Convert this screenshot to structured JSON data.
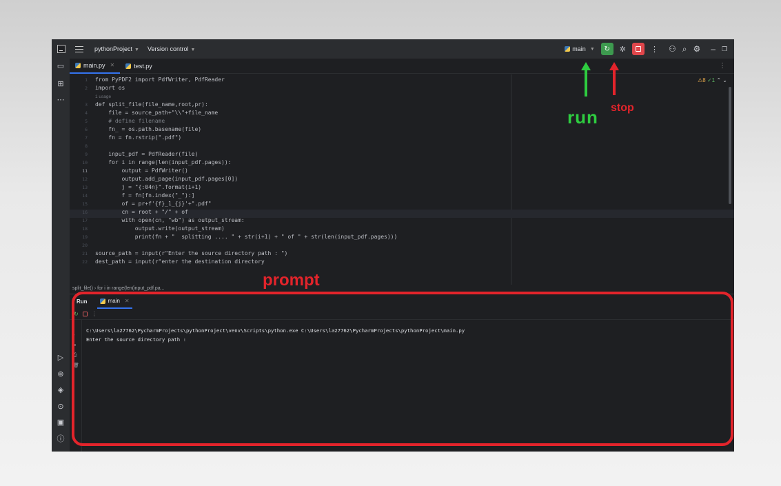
{
  "titlebar": {
    "project": "pythonProject",
    "vcs": "Version control",
    "branch": "main"
  },
  "tabs": [
    {
      "label": "main.py"
    },
    {
      "label": "test.py"
    }
  ],
  "editor": {
    "inspections": {
      "warnings": "8",
      "ok": "1"
    },
    "usage_hint": "1 usage",
    "lines": [
      {
        "num": "1",
        "text": "from PyPDF2 import PdfWriter, PdfReader"
      },
      {
        "num": "2",
        "text": "import os"
      },
      {
        "num": "3",
        "text": "def split_file(file_name,root,pr):"
      },
      {
        "num": "4",
        "text": "    file = source_path+\"\\\\\"+file_name"
      },
      {
        "num": "5",
        "text": "    # define filename"
      },
      {
        "num": "6",
        "text": "    fn_ = os.path.basename(file)"
      },
      {
        "num": "7",
        "text": "    fn = fn.rstrip(\".pdf\")"
      },
      {
        "num": "8",
        "text": ""
      },
      {
        "num": "9",
        "text": "    input_pdf = PdfReader(file)"
      },
      {
        "num": "10",
        "text": "    for i in range(len(input_pdf.pages)):"
      },
      {
        "num": "11",
        "text": "        output = PdfWriter()"
      },
      {
        "num": "12",
        "text": "        output.add_page(input_pdf.pages[0])"
      },
      {
        "num": "13",
        "text": "        j = \"{:04n}\".format(i+1)"
      },
      {
        "num": "14",
        "text": "        f = fn[fn.index(\"_\"):]"
      },
      {
        "num": "15",
        "text": "        of = pr+f'{f}_1_{j}'+\".pdf\""
      },
      {
        "num": "16",
        "text": "        cn = root + \"/\" + of"
      },
      {
        "num": "17",
        "text": "        with open(cn, \"wb\") as output_stream:"
      },
      {
        "num": "18",
        "text": "            output.write(output_stream)"
      },
      {
        "num": "19",
        "text": "            print(fn + \"  splitting .... \" + str(i+1) + \" of \" + str(len(input_pdf.pages)))"
      },
      {
        "num": "20",
        "text": ""
      },
      {
        "num": "21",
        "text": "source_path = input(r\"Enter the source directory path : \")"
      },
      {
        "num": "22",
        "text": "dest_path = input(r\"enter the destination directory"
      }
    ],
    "breadcrumb": "split_file()  ›  for i in range(len(input_pdf.pa..."
  },
  "run_window": {
    "title": "Run",
    "tab": "main",
    "console_lines": [
      "C:\\Users\\la27762\\PycharmProjects\\pythonProject\\venv\\Scripts\\python.exe C:\\Users\\la27762\\PycharmProjects\\pythonProject\\main.py",
      "Enter the source directory path :"
    ]
  },
  "annotations": {
    "run": "run",
    "stop": "stop",
    "prompt": "prompt",
    "run_color": "#2ecc40",
    "stop_color": "#e3242b"
  }
}
